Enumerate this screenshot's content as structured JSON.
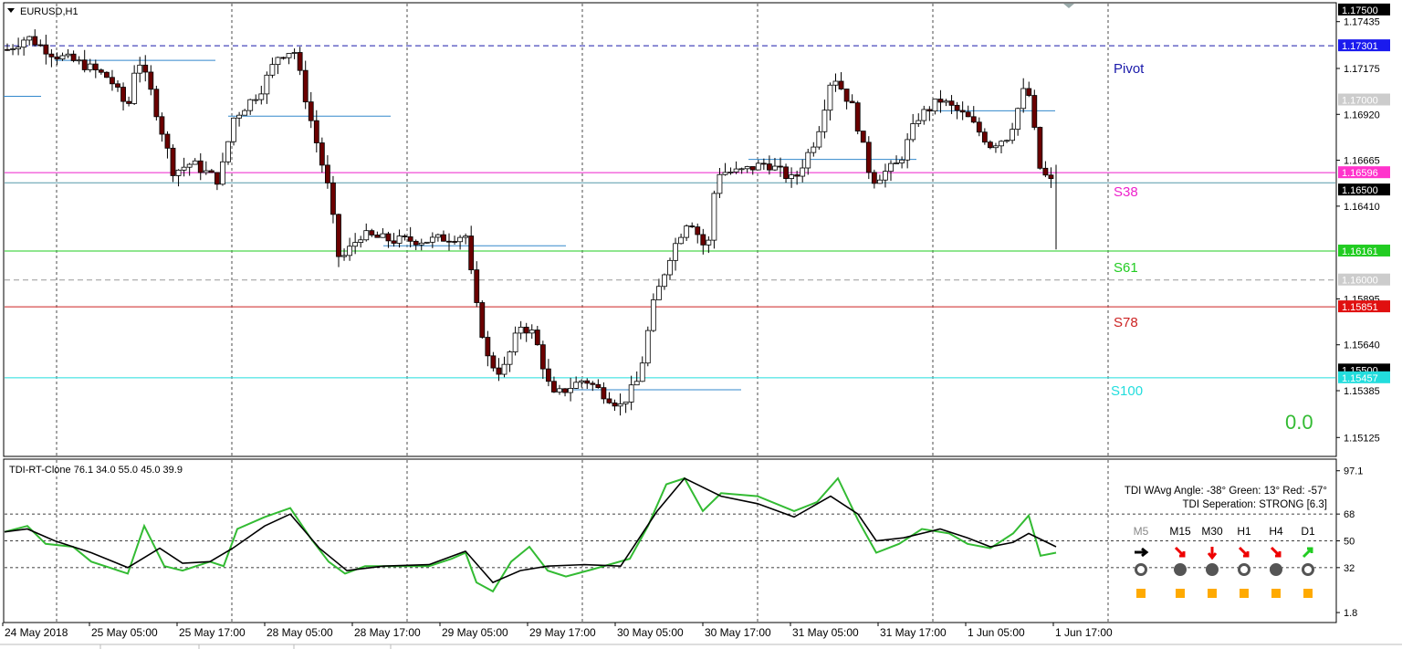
{
  "window": {
    "symbol_label": "EURUSD,H1"
  },
  "price_axis": {
    "ticks": [
      "1.17435",
      "1.17175",
      "1.16920",
      "1.16665",
      "1.16410",
      "1.15895",
      "1.15640",
      "1.15385",
      "1.15125"
    ],
    "range": [
      1.1502,
      1.1754
    ]
  },
  "price_tags": [
    {
      "text": "1.17500",
      "price": 1.175,
      "bg": "#000000",
      "fg": "#ffffff"
    },
    {
      "text": "1.17301",
      "price": 1.17301,
      "bg": "#1a1aee",
      "fg": "#ffffff"
    },
    {
      "text": "1.17000",
      "price": 1.17,
      "bg": "#cccccc",
      "fg": "#ffffff"
    },
    {
      "text": "1.16596",
      "price": 1.16596,
      "bg": "#ff33cc",
      "fg": "#ffffff"
    },
    {
      "text": "1.16500",
      "price": 1.165,
      "bg": "#000000",
      "fg": "#ffffff"
    },
    {
      "text": "1.16161",
      "price": 1.16161,
      "bg": "#22cc22",
      "fg": "#ffffff"
    },
    {
      "text": "1.16000",
      "price": 1.16,
      "bg": "#cccccc",
      "fg": "#ffffff"
    },
    {
      "text": "1.15851",
      "price": 1.15851,
      "bg": "#e01010",
      "fg": "#ffffff"
    },
    {
      "text": "1.15500",
      "price": 1.155,
      "bg": "#000000",
      "fg": "#ffffff"
    },
    {
      "text": "1.15457",
      "price": 1.15457,
      "bg": "#22dddd",
      "fg": "#ffffff"
    }
  ],
  "levels": [
    {
      "name": "Pivot",
      "price": 1.17301,
      "color": "#1a1aaa",
      "dash": true
    },
    {
      "name": "S38",
      "price": 1.16596,
      "color": "#ee22cc",
      "dash": false
    },
    {
      "name": "",
      "price": 1.1654,
      "color": "#5599aa",
      "dash": false
    },
    {
      "name": "S61",
      "price": 1.16161,
      "color": "#22cc22",
      "dash": false
    },
    {
      "name": "",
      "price": 1.16,
      "color": "#999999",
      "dash": true
    },
    {
      "name": "S78",
      "price": 1.15851,
      "color": "#cc2222",
      "dash": false
    },
    {
      "name": "S100",
      "price": 1.15457,
      "color": "#22dddd",
      "dash": false
    }
  ],
  "level_names": {
    "pivot": "Pivot",
    "s38": "S38",
    "s61": "S61",
    "s78": "S78",
    "s100": "S100"
  },
  "big_value": "0.0",
  "time_axis": [
    "24 May 2018",
    "25 May 05:00",
    "25 May 17:00",
    "28 May 05:00",
    "28 May 17:00",
    "29 May 05:00",
    "29 May 17:00",
    "30 May 05:00",
    "30 May 17:00",
    "31 May 05:00",
    "31 May 17:00",
    "1 Jun 05:00",
    "1 Jun 17:00"
  ],
  "indicator": {
    "title": "TDI-RT-Clone 76.1 34.0 55.0 45.0 39.9",
    "axis_ticks": [
      "97.1",
      "68",
      "50",
      "32",
      "1.8"
    ],
    "range": [
      0,
      100
    ],
    "info_line1": "TDI WAvg Angle: -38°  Green: 13°  Red: -57°",
    "info_line2": "TDI Seperation: STRONG [6.3]",
    "timeframes": [
      {
        "label": "M5",
        "active": false,
        "arrow": "right",
        "arrow_color": "#000000"
      },
      {
        "label": "M15",
        "active": true,
        "arrow": "down-right",
        "arrow_color": "#ee0000"
      },
      {
        "label": "M30",
        "active": true,
        "arrow": "down",
        "arrow_color": "#ee0000"
      },
      {
        "label": "H1",
        "active": true,
        "arrow": "down-right",
        "arrow_color": "#ee0000"
      },
      {
        "label": "H4",
        "active": true,
        "arrow": "down-right",
        "arrow_color": "#ee0000"
      },
      {
        "label": "D1",
        "active": true,
        "arrow": "up-right",
        "arrow_color": "#22cc22"
      }
    ]
  },
  "colors": {
    "bull_fill": "#ffffff",
    "bear_fill": "#6b0000",
    "green_line": "#33bb33",
    "black_line": "#000000"
  }
}
